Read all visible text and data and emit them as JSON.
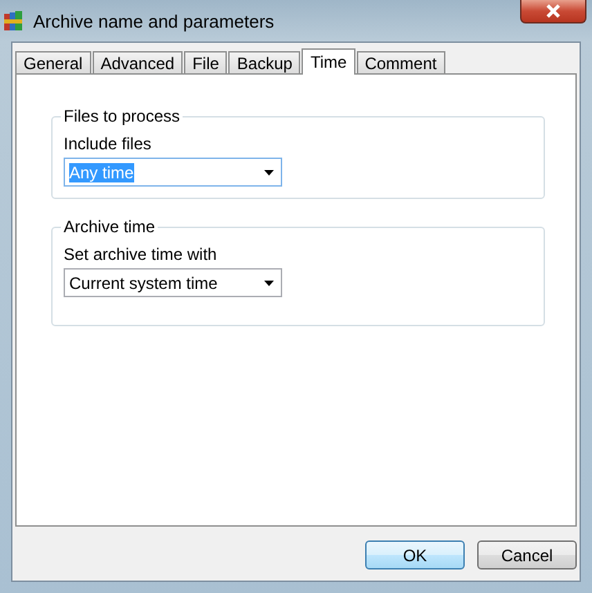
{
  "window": {
    "title": "Archive name and parameters"
  },
  "tabs": [
    {
      "label": "General",
      "selected": false
    },
    {
      "label": "Advanced",
      "selected": false
    },
    {
      "label": "File",
      "selected": false
    },
    {
      "label": "Backup",
      "selected": false
    },
    {
      "label": "Time",
      "selected": true
    },
    {
      "label": "Comment",
      "selected": false
    }
  ],
  "groups": [
    {
      "title": "Files to process",
      "label": "Include files",
      "value": "Any time",
      "focused": true
    },
    {
      "title": "Archive time",
      "label": "Set archive time with",
      "value": "Current system time",
      "focused": false
    }
  ],
  "buttons": [
    {
      "label": "OK",
      "default": true
    },
    {
      "label": "Cancel",
      "default": false
    }
  ]
}
